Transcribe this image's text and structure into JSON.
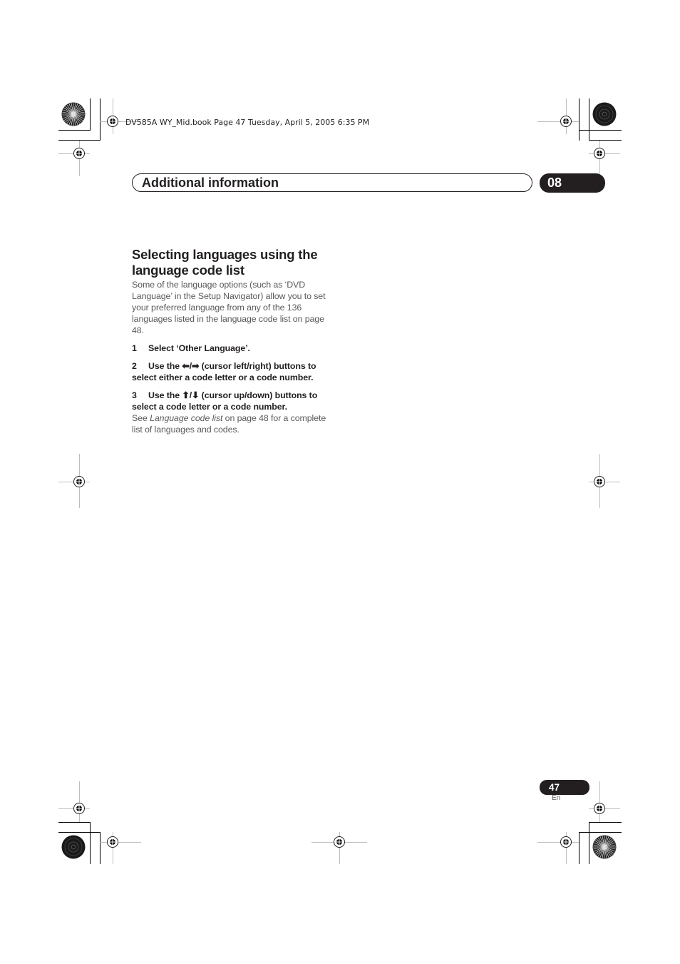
{
  "slug": {
    "text": "DV585A WY_Mid.book  Page 47  Tuesday, April 5, 2005  6:35 PM"
  },
  "header": {
    "title": "Additional information",
    "chapter": "08"
  },
  "section": {
    "title_line1": "Selecting languages using the",
    "title_line2": "language code list",
    "intro": "Some of the language options (such as ‘DVD Language’ in the Setup Navigator) allow you to set your preferred language from any of the 136 languages listed in the language code list on page 48.",
    "steps": [
      {
        "num": "1",
        "text": "Select ‘Other Language’."
      },
      {
        "num": "2",
        "text_pre": "Use the ",
        "icon_a": "⬅",
        "sep": "/",
        "icon_b": "➡",
        "text_post": " (cursor left/right) buttons to select either a code letter or a code number."
      },
      {
        "num": "3",
        "text_pre": "Use the ",
        "icon_a": "⬆",
        "sep": "/",
        "icon_b": "⬇",
        "text_post": " (cursor up/down) buttons to select a code letter or a code number."
      }
    ],
    "note": {
      "pre": "See ",
      "link": "Language code list",
      "post": " on page 48 for a complete list of languages and codes."
    }
  },
  "footer": {
    "page_number": "47",
    "language": "En"
  },
  "icons": {
    "registration_mark": "registration-crosshair",
    "color_bar": "starburst-target"
  }
}
